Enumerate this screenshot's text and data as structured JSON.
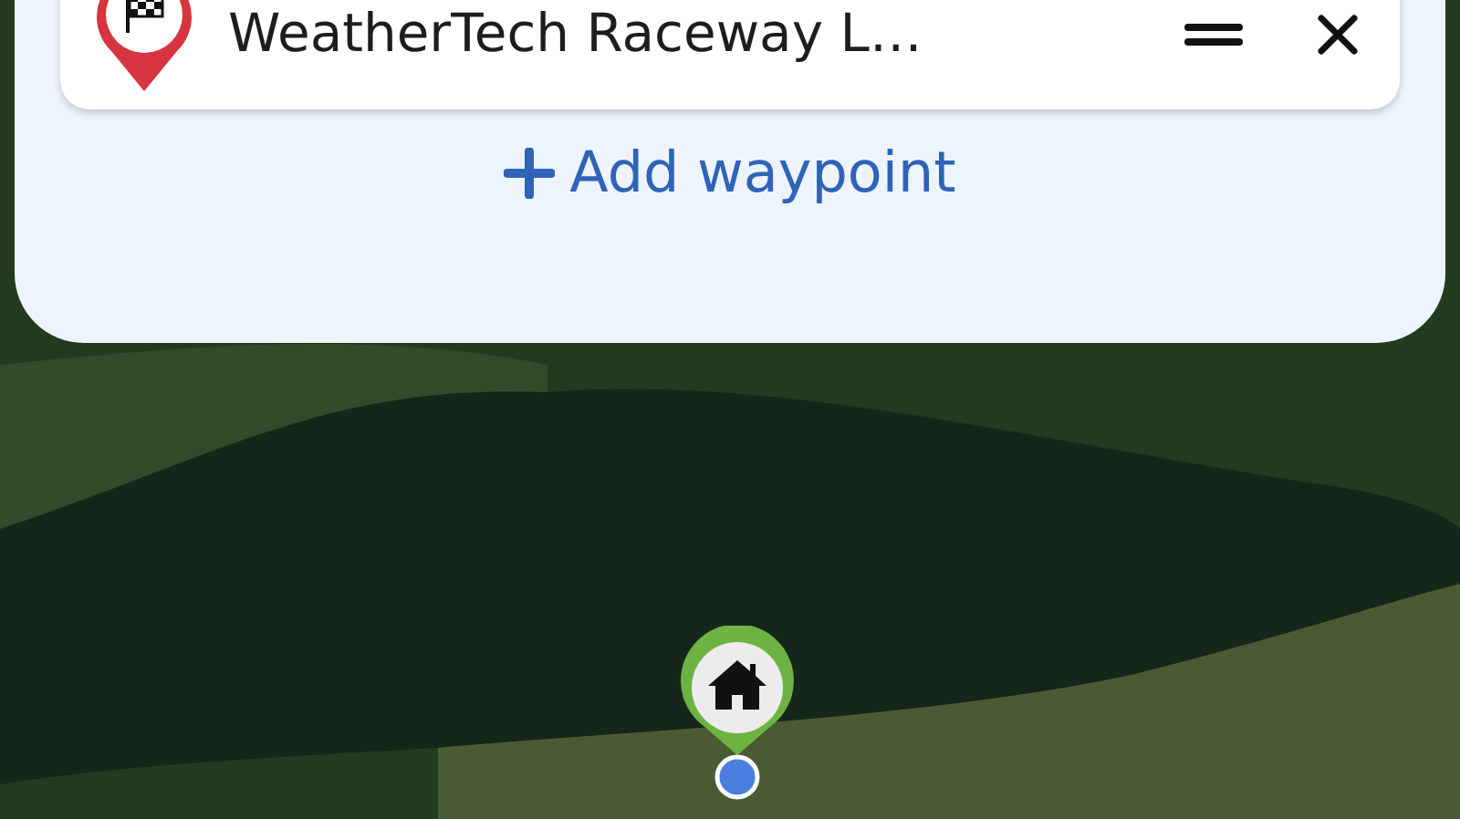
{
  "route_panel": {
    "waypoints": [
      {
        "name": "WeatherTech Raceway L…",
        "kind": "finish"
      }
    ],
    "add_button": {
      "label": "Add waypoint"
    }
  },
  "map": {
    "markers": [
      {
        "kind": "home"
      }
    ]
  }
}
